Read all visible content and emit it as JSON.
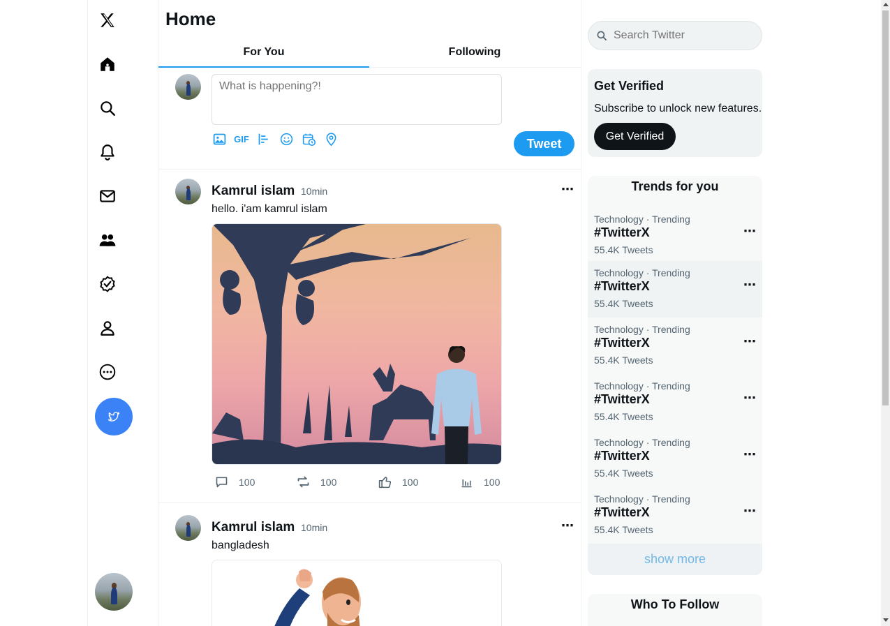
{
  "nav": {
    "items": [
      {
        "icon": "x-logo-icon"
      },
      {
        "icon": "home-icon"
      },
      {
        "icon": "search-icon"
      },
      {
        "icon": "bell-icon"
      },
      {
        "icon": "mail-icon"
      },
      {
        "icon": "communities-icon"
      },
      {
        "icon": "verified-icon"
      },
      {
        "icon": "profile-icon"
      },
      {
        "icon": "more-icon"
      }
    ],
    "tweet_fab_icon": "bird-icon"
  },
  "main": {
    "title": "Home",
    "tabs": [
      {
        "label": "For You",
        "active": true
      },
      {
        "label": "Following",
        "active": false
      }
    ],
    "composer": {
      "placeholder": "What is happening?!",
      "gif_label": "GIF",
      "tweet_button": "Tweet"
    },
    "posts": [
      {
        "name": "Kamrul islam",
        "time": "10min",
        "text": "hello. i'am kamrul islam",
        "more": "⋯",
        "actions": {
          "replies": "100",
          "retweets": "100",
          "likes": "100",
          "views": "100"
        }
      },
      {
        "name": "Kamrul islam",
        "time": "10min",
        "text": "bangladesh",
        "more": "⋯"
      }
    ]
  },
  "right": {
    "search_placeholder": "Search Twitter",
    "verified": {
      "title": "Get Verified",
      "subtitle": "Subscribe to unlock new features.",
      "button": "Get Verified"
    },
    "trends": {
      "title": "Trends for you",
      "items": [
        {
          "meta": "Technology · Trending",
          "tag": "#TwitterX",
          "count": "55.4K Tweets",
          "more": "⋯"
        },
        {
          "meta": "Technology · Trending",
          "tag": "#TwitterX",
          "count": "55.4K Tweets",
          "more": "⋯"
        },
        {
          "meta": "Technology · Trending",
          "tag": "#TwitterX",
          "count": "55.4K Tweets",
          "more": "⋯"
        },
        {
          "meta": "Technology · Trending",
          "tag": "#TwitterX",
          "count": "55.4K Tweets",
          "more": "⋯"
        },
        {
          "meta": "Technology · Trending",
          "tag": "#TwitterX",
          "count": "55.4K Tweets",
          "more": "⋯"
        },
        {
          "meta": "Technology · Trending",
          "tag": "#TwitterX",
          "count": "55.4K Tweets",
          "more": "⋯"
        }
      ],
      "show_more": "show more"
    },
    "who_to_follow": {
      "title": "Who To Follow"
    }
  },
  "colors": {
    "accent": "#1d9bf0",
    "fab": "#3b82f6",
    "text": "#0f1419",
    "muted": "#536471"
  }
}
